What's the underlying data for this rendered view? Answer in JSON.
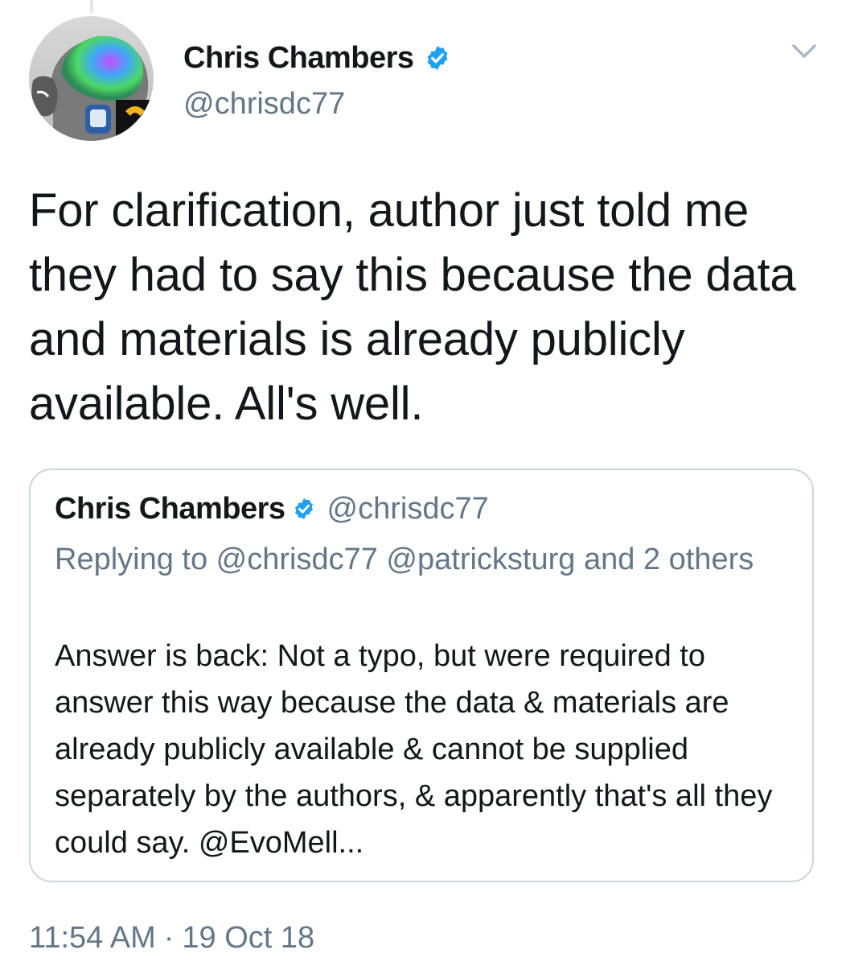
{
  "tweet": {
    "author": {
      "name": "Chris Chambers",
      "handle": "@chrisdc77",
      "verified": true,
      "verified_color": "#1da1f2"
    },
    "text": "For clarification, author just told me they had to say this because the data and materials is already publicly available. All's well.",
    "time": "11:54 AM",
    "separator": "·",
    "date": "19 Oct 18",
    "menu_icon": "chevron-down-icon"
  },
  "quoted_tweet": {
    "author": {
      "name": "Chris Chambers",
      "handle": "@chrisdc77",
      "verified": true
    },
    "replying_to": "Replying to @chrisdc77 @patricksturg and 2 others",
    "text": "Answer is back: Not a typo, but were required to answer this way because the data & materials are already publicly available & cannot be supplied separately by the authors, & apparently that's all they could say. @EvoMell..."
  },
  "colors": {
    "text_primary": "#14171a",
    "text_secondary": "#657786",
    "border": "#ccd6dd",
    "accent": "#1da1f2"
  }
}
